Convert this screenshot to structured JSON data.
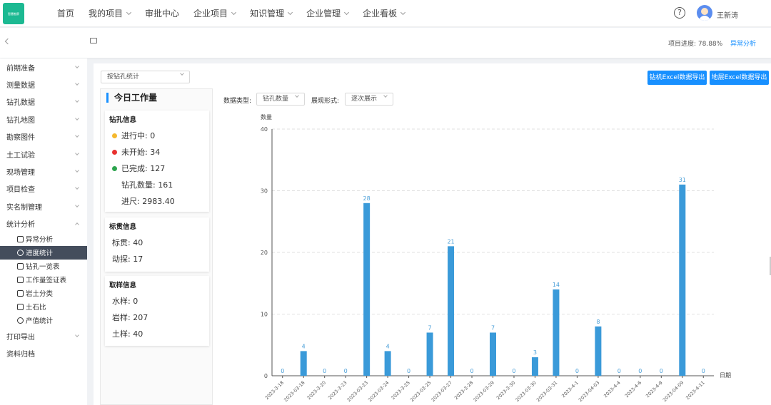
{
  "header": {
    "logo_text": "智慧勘察",
    "nav": [
      {
        "label": "首页",
        "has_menu": false
      },
      {
        "label": "我的项目",
        "has_menu": true
      },
      {
        "label": "审批中心",
        "has_menu": false
      },
      {
        "label": "企业项目",
        "has_menu": true
      },
      {
        "label": "知识管理",
        "has_menu": true
      },
      {
        "label": "企业管理",
        "has_menu": true
      },
      {
        "label": "企业看板",
        "has_menu": true
      }
    ],
    "help_glyph": "?",
    "username": "王新涛"
  },
  "subbar": {
    "progress_label": "项目进度: 78.88%",
    "abnormal_link": "异常分析"
  },
  "sidebar": {
    "items": [
      {
        "label": "前期准备"
      },
      {
        "label": "测量数据"
      },
      {
        "label": "钻孔数据"
      },
      {
        "label": "钻孔地图"
      },
      {
        "label": "勘察图件"
      },
      {
        "label": "土工试验"
      },
      {
        "label": "现场管理"
      },
      {
        "label": "项目检查"
      },
      {
        "label": "实名制管理"
      },
      {
        "label": "统计分析"
      }
    ],
    "sub_items": [
      {
        "label": "异常分析",
        "icon": "shield-icon"
      },
      {
        "label": "进度统计",
        "icon": "clock-icon"
      },
      {
        "label": "钻孔一览表",
        "icon": "table-icon"
      },
      {
        "label": "工作量签证表",
        "icon": "form-icon"
      },
      {
        "label": "岩土分类",
        "icon": "grid-icon"
      },
      {
        "label": "土石比",
        "icon": "list-icon"
      },
      {
        "label": "产值统计",
        "icon": "money-icon"
      }
    ],
    "bottom_items": [
      {
        "label": "打印导出"
      },
      {
        "label": "资料归档"
      }
    ]
  },
  "main": {
    "stat_select": "按钻孔统计",
    "export_rig_btn": "钻机Excel数据导出",
    "export_layer_btn": "地层Excel数据导出",
    "data_type_label": "数据类型:",
    "data_type_value": "钻孔数量",
    "display_label": "展现形式:",
    "display_value": "逐次展示"
  },
  "panel": {
    "title": "今日工作量",
    "drill_title": "钻孔信息",
    "in_progress": "进行中: 0",
    "not_started": "未开始: 34",
    "completed": "已完成: 127",
    "drill_count": "钻孔数量: 161",
    "footage": "进尺: 2983.40",
    "standard_title": "标贯信息",
    "standard_pen": "标贯: 40",
    "dynamic_probe": "动探: 17",
    "sample_title": "取样信息",
    "water_sample": "水样: 0",
    "rock_sample": "岩样: 207",
    "soil_sample": "土样: 40",
    "colors": {
      "in_progress": "#f5b82e",
      "not_started": "#e8312f",
      "completed": "#2da44e"
    }
  },
  "chart_data": {
    "type": "bar",
    "ylabel": "数量",
    "xlabel": "日期",
    "ylim": [
      0,
      40
    ],
    "yticks": [
      0,
      10,
      20,
      30,
      40
    ],
    "grid": true,
    "bar_color": "#3a9ad9",
    "categories": [
      "2023-3-18",
      "2023-03-18",
      "2023-3-20",
      "2023-3-23",
      "2023-03-23",
      "2023-03-24",
      "2023-3-25",
      "2023-03-25",
      "2023-03-27",
      "2023-3-28",
      "2023-03-29",
      "2023-3-30",
      "2023-03-30",
      "2023-03-31",
      "2023-4-1",
      "2023-04-03",
      "2023-4-4",
      "2023-4-6",
      "2023-4-9",
      "2023-04-09",
      "2023-4-11"
    ],
    "values": [
      0,
      4,
      0,
      0,
      28,
      4,
      0,
      7,
      21,
      0,
      7,
      0,
      3,
      14,
      0,
      8,
      0,
      0,
      0,
      31,
      0
    ]
  }
}
